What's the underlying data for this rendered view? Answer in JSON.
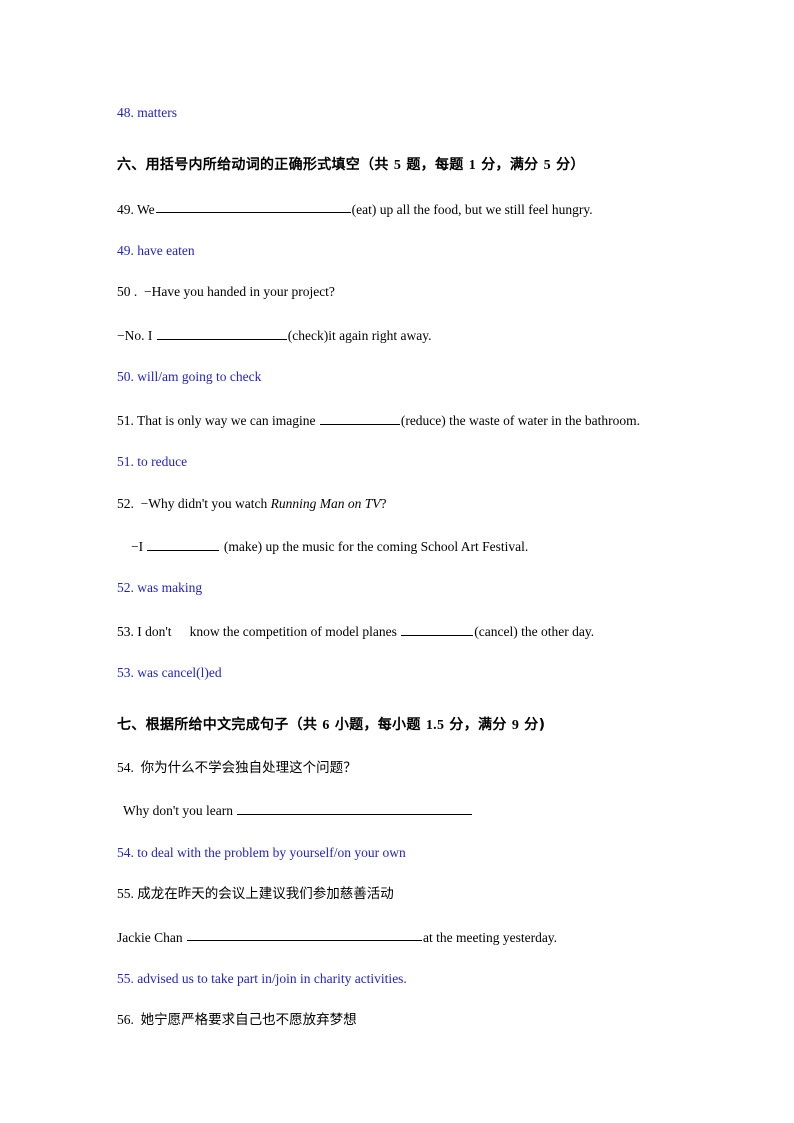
{
  "page": {
    "background_color": "#ffffff",
    "text_color": "#000000",
    "answer_color": "#2222cc"
  },
  "answers": {
    "a48": "48. matters",
    "a49": "49. have eaten",
    "a50": "50. will/am going to check",
    "a51": "51. to reduce",
    "a52": "52. was making",
    "a53": "53. was cancel(l)ed",
    "a54": "54. to deal with the problem by yourself/on your own",
    "a55": "55. advised us to take part in/join in charity activities."
  },
  "section_six": {
    "heading": "六、用括号内所给动词的正确形式填空（共 5 题，每题 1 分，满分 5 分）",
    "heading_parts": {
      "label": "六、用括号内所给动词的正确形式填空（共 ",
      "count": "5",
      "mid1": " 题，每题 ",
      "per": "1",
      "mid2": " 分，满分 ",
      "total": "5",
      "tail": " 分）"
    },
    "q49": {
      "prefix": "49. We",
      "suffix": "(eat) up all the food, but we still feel hungry."
    },
    "q50": {
      "line1": "50 .  −Have you handed in your project?",
      "line2_prefix": "−No. I ",
      "line2_suffix": "(check)it again right away."
    },
    "q51": {
      "prefix": "51. That is only way we can imagine ",
      "suffix": "(reduce) the waste of water in the bathroom."
    },
    "q52": {
      "line1_prefix": "52.  −Why didn't you watch ",
      "line1_italic": "Running Man on TV",
      "line1_suffix": "?",
      "line2_prefix": "−I ",
      "line2_suffix": " (make) up the music for the coming School Art Festival."
    },
    "q53": {
      "prefix": "53. I don't",
      "prefix2": "know the competition of model planes ",
      "suffix": "(cancel) the other day."
    }
  },
  "section_seven": {
    "heading": "七、根据所给中文完成句子（共 6 小题，每小题 1.5 分，满分 9 分)",
    "heading_parts": {
      "label": "七、根据所给中文完成句子（共 ",
      "count": "6",
      "mid1": " 小题，每小题 ",
      "per": "1.5",
      "mid2": " 分，满分 ",
      "total": "9",
      "tail": " 分)"
    },
    "q54": {
      "chinese": "54.  你为什么不学会独自处理这个问题？",
      "english_prefix": "Why don't you learn "
    },
    "q55": {
      "chinese": "55. 成龙在昨天的会议上建议我们参加慈善活动",
      "english_prefix": "Jackie Chan ",
      "english_suffix": "at the meeting yesterday."
    },
    "q56": {
      "chinese": "56.  她宁愿严格要求自己也不愿放弃梦想"
    }
  }
}
